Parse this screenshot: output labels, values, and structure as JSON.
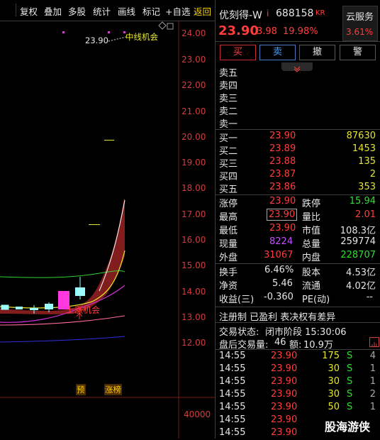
{
  "toolbar": {
    "items": [
      "复权",
      "叠加",
      "多股",
      "统计",
      "画线",
      "标记",
      "+自选",
      "返回"
    ]
  },
  "chart": {
    "price_labels": [
      "24.00",
      "23.00",
      "22.00",
      "21.00",
      "20.00",
      "19.00",
      "18.00",
      "17.00",
      "16.00",
      "15.00",
      "14.00",
      "13.00",
      "12.00"
    ],
    "volume_label": "40000",
    "annotation_price": "23.90",
    "annotation_text": "中线机会",
    "signal_text": "上涨机会",
    "tag_pre": "预",
    "tag_limit": "涨榜"
  },
  "header": {
    "name": "优刻得-W",
    "mark": "i",
    "code": "688158",
    "code_suffix": "KR",
    "cloud_tag": "云服务",
    "cloud_pct": "3.61%",
    "price": "23.90",
    "change": "3.98",
    "change_pct": "19.98%"
  },
  "actions": {
    "buy": "买",
    "sell": "卖",
    "cancel": "撤",
    "alert": "警"
  },
  "asks": [
    {
      "label": "卖五",
      "price": "",
      "vol": ""
    },
    {
      "label": "卖四",
      "price": "",
      "vol": ""
    },
    {
      "label": "卖三",
      "price": "",
      "vol": ""
    },
    {
      "label": "卖二",
      "price": "",
      "vol": ""
    },
    {
      "label": "卖一",
      "price": "",
      "vol": ""
    }
  ],
  "bids": [
    {
      "label": "买一",
      "price": "23.90",
      "vol": "87630"
    },
    {
      "label": "买二",
      "price": "23.89",
      "vol": "1453"
    },
    {
      "label": "买三",
      "price": "23.88",
      "vol": "135"
    },
    {
      "label": "买四",
      "price": "23.87",
      "vol": "2"
    },
    {
      "label": "买五",
      "price": "23.86",
      "vol": "353"
    }
  ],
  "stats": {
    "limit_up_label": "涨停",
    "limit_up": "23.90",
    "limit_down_label": "跌停",
    "limit_down": "15.94",
    "high_label": "最高",
    "high": "23.90",
    "vol_ratio_label": "量比",
    "vol_ratio": "2.01",
    "low_label": "最低",
    "low": "23.90",
    "mkt_cap_label": "市值",
    "mkt_cap": "108.3亿",
    "current_vol_label": "现量",
    "current_vol": "8224",
    "total_vol_label": "总量",
    "total_vol": "259774",
    "outer_label": "外盘",
    "outer": "31067",
    "inner_label": "内盘",
    "inner": "228707",
    "turnover_label": "换手",
    "turnover": "6.46%",
    "share_cap_label": "股本",
    "share_cap": "4.53亿",
    "nav_label": "净资",
    "nav": "5.46",
    "float_label": "流通",
    "float": "4.02亿",
    "eps_label": "收益(三)",
    "eps": "-0.360",
    "pe_label": "PE(动)",
    "pe": "--"
  },
  "notice": "注册制 已盈利 表决权有差异",
  "trade_status": {
    "label": "交易状态:",
    "value": "闭市阶段 15:30:06"
  },
  "after_hours": {
    "label": "盘后交易量:",
    "volume": "46",
    "amount_label": "额:",
    "amount": "10.9万"
  },
  "ticks": [
    {
      "time": "14:55",
      "price": "23.90",
      "vol": "175",
      "side": "S",
      "count": "4"
    },
    {
      "time": "14:55",
      "price": "23.90",
      "vol": "30",
      "side": "S",
      "count": "1"
    },
    {
      "time": "14:55",
      "price": "23.90",
      "vol": "30",
      "side": "S",
      "count": "1"
    },
    {
      "time": "14:55",
      "price": "23.90",
      "vol": "30",
      "side": "S",
      "count": "2"
    },
    {
      "time": "14:55",
      "price": "23.90",
      "vol": "50",
      "side": "S",
      "count": "1"
    },
    {
      "time": "14:55",
      "price": "23.90",
      "vol": "",
      "side": "",
      "count": ""
    },
    {
      "time": "14:55",
      "price": "23.90",
      "vol": "",
      "side": "",
      "count": ""
    }
  ],
  "watermark": "股海游侠"
}
